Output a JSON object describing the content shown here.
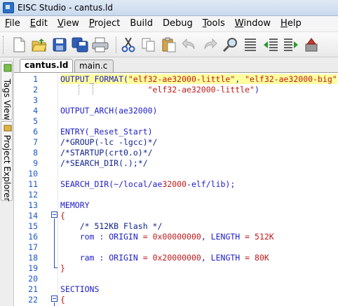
{
  "window": {
    "title": "EISC Studio - cantus.ld"
  },
  "menu": [
    {
      "pre": "",
      "u": "F",
      "post": "ile"
    },
    {
      "pre": "",
      "u": "E",
      "post": "dit"
    },
    {
      "pre": "",
      "u": "V",
      "post": "iew"
    },
    {
      "pre": "",
      "u": "P",
      "post": "roject"
    },
    {
      "pre": "Build",
      "u": "",
      "post": ""
    },
    {
      "pre": "Debug",
      "u": "",
      "post": ""
    },
    {
      "pre": "",
      "u": "T",
      "post": "ools"
    },
    {
      "pre": "",
      "u": "W",
      "post": "indow"
    },
    {
      "pre": "",
      "u": "H",
      "post": "elp"
    }
  ],
  "toolbar": {
    "icons": [
      "new-file-icon",
      "open-folder-icon",
      "save-icon",
      "save-all-icon",
      "print-icon",
      "cut-icon",
      "copy-icon",
      "paste-icon",
      "undo-icon",
      "redo-icon",
      "find-icon",
      "replace-icon",
      "outdent-icon",
      "indent-icon",
      "build-icon"
    ]
  },
  "side_panel": {
    "tags_view": "Tags View",
    "project_explorer": "Project Explorer"
  },
  "tabs": [
    {
      "label": "cantus.ld",
      "active": true
    },
    {
      "label": "main.c",
      "active": false
    }
  ],
  "colors": {
    "line_number": "#1c57c4",
    "keyword": "#2020c8",
    "string": "#c01818",
    "highlight": "#ffff9e",
    "fold_marker": "#2a4cb5"
  },
  "editor": {
    "lines": [
      {
        "n": "1",
        "segs": [
          [
            "kw",
            "OUTPUT_FORMAT("
          ],
          [
            "str",
            "\"elf32-ae32000-little\""
          ],
          [
            "kw",
            ", "
          ],
          [
            "str",
            "\"elf32-ae32000-big\""
          ]
        ],
        "hl": true
      },
      {
        "n": "2",
        "segs": [
          [
            "kw",
            "                  "
          ],
          [
            "str",
            "\"elf32-ae32000-little\""
          ],
          [
            "kw",
            ")"
          ]
        ],
        "hl": false
      },
      {
        "n": "3",
        "segs": [],
        "hl": false
      },
      {
        "n": "4",
        "segs": [
          [
            "kw",
            "OUTPUT_ARCH(ae32000)"
          ]
        ],
        "hl": false
      },
      {
        "n": "5",
        "segs": [],
        "hl": false
      },
      {
        "n": "6",
        "segs": [
          [
            "kw",
            "ENTRY(_Reset_Start)"
          ]
        ],
        "hl": false
      },
      {
        "n": "7",
        "segs": [
          [
            "cm",
            "/*GROUP(-lc -lgcc)*/"
          ]
        ],
        "hl": false
      },
      {
        "n": "8",
        "segs": [
          [
            "cm",
            "/*STARTUP(crt0.o)*/"
          ]
        ],
        "hl": false
      },
      {
        "n": "9",
        "segs": [
          [
            "cm",
            "/*SEARCH_DIR(.);*/"
          ]
        ],
        "hl": false
      },
      {
        "n": "10",
        "segs": [],
        "hl": false
      },
      {
        "n": "11",
        "segs": [
          [
            "kw",
            "SEARCH_DIR(~/local/ae"
          ],
          [
            "num",
            "32000"
          ],
          [
            "kw",
            "-elf/lib);"
          ]
        ],
        "hl": false
      },
      {
        "n": "12",
        "segs": [],
        "hl": false
      },
      {
        "n": "13",
        "segs": [
          [
            "kw",
            "MEMORY"
          ]
        ],
        "hl": false
      },
      {
        "n": "14",
        "segs": [
          [
            "brace",
            "{"
          ]
        ],
        "hl": false,
        "fold": true
      },
      {
        "n": "15",
        "segs": [
          [
            "cm",
            "    /* 512KB Flash */"
          ]
        ],
        "hl": false
      },
      {
        "n": "16",
        "segs": [
          [
            "kw",
            "    rom : ORIGIN "
          ],
          [
            "op",
            "="
          ],
          [
            "kw",
            " "
          ],
          [
            "num",
            "0x00000000"
          ],
          [
            "kw",
            ", LENGTH "
          ],
          [
            "op",
            "="
          ],
          [
            "kw",
            " "
          ],
          [
            "num",
            "512K"
          ]
        ],
        "hl": false
      },
      {
        "n": "17",
        "segs": [],
        "hl": false
      },
      {
        "n": "18",
        "segs": [
          [
            "kw",
            "    ram : ORIGIN "
          ],
          [
            "op",
            "="
          ],
          [
            "kw",
            " "
          ],
          [
            "num",
            "0x20000000"
          ],
          [
            "kw",
            ", LENGTH "
          ],
          [
            "op",
            "="
          ],
          [
            "kw",
            " "
          ],
          [
            "num",
            "80K"
          ]
        ],
        "hl": false
      },
      {
        "n": "19",
        "segs": [
          [
            "brace",
            "}"
          ]
        ],
        "hl": false,
        "foldend": true
      },
      {
        "n": "20",
        "segs": [],
        "hl": false
      },
      {
        "n": "21",
        "segs": [
          [
            "kw",
            "SECTIONS"
          ]
        ],
        "hl": false
      },
      {
        "n": "22",
        "segs": [
          [
            "brace",
            "{"
          ]
        ],
        "hl": false,
        "fold": true
      }
    ]
  }
}
